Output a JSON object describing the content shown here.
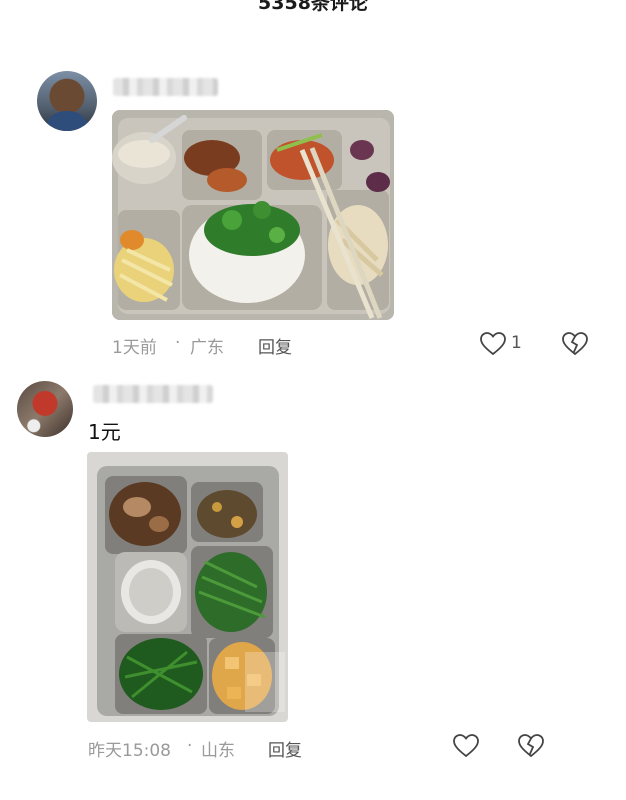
{
  "header": {
    "title": "5358条评论"
  },
  "comments": [
    {
      "text": "",
      "time": "1天前",
      "separator": "·",
      "location": "广东",
      "reply_label": "回复",
      "like_count": "1"
    },
    {
      "text": "1元",
      "time": "昨天15:08",
      "separator": "·",
      "location": "山东",
      "reply_label": "回复",
      "like_count": ""
    }
  ],
  "icons": {
    "like": "heart-icon",
    "dislike": "broken-heart-icon"
  }
}
